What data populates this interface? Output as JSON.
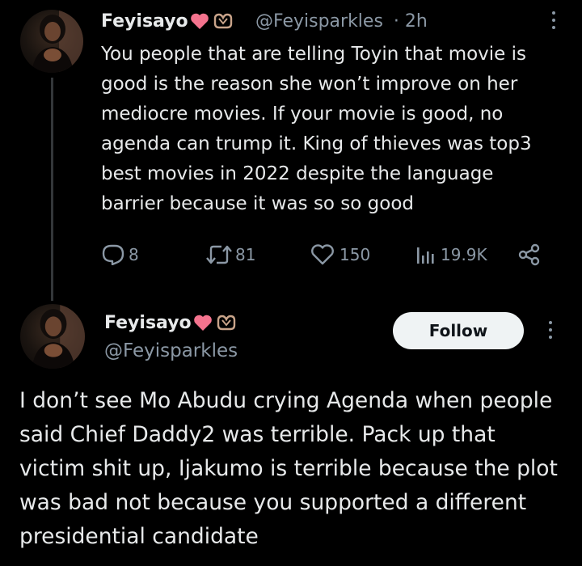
{
  "colors": {
    "background": "#000000",
    "text": "#e7e9ea",
    "secondary": "#8b98a5",
    "heart": "#f4738e",
    "follow_bg": "#eff3f4"
  },
  "first_post": {
    "author_name": "Feyisayo",
    "handle": "@Feyisparkles",
    "timestamp": "· 2h",
    "body": "You people that are telling Toyin that movie is good is the reason she won’t improve on her mediocre movies. If your movie is good, no agenda can trump it. King of thieves was top3 best movies in 2022 despite the language barrier because it was so so good",
    "actions": {
      "replies": "8",
      "reposts": "81",
      "likes": "150",
      "views": "19.9K"
    }
  },
  "second_post": {
    "author_name": "Feyisayo",
    "handle": "@Feyisparkles",
    "follow_label": "Follow",
    "body": "I don’t see Mo Abudu crying Agenda when people said Chief Daddy2 was terrible. Pack up that victim shit up, Ijakumo is terrible because the plot was bad not because you supported a different presidential candidate"
  },
  "icons": {
    "name_badges": [
      "heart-emoji",
      "heart-hands-emoji"
    ],
    "actions": [
      "reply-icon",
      "repost-icon",
      "like-icon",
      "views-icon",
      "share-icon"
    ],
    "more": "more-options-icon"
  }
}
